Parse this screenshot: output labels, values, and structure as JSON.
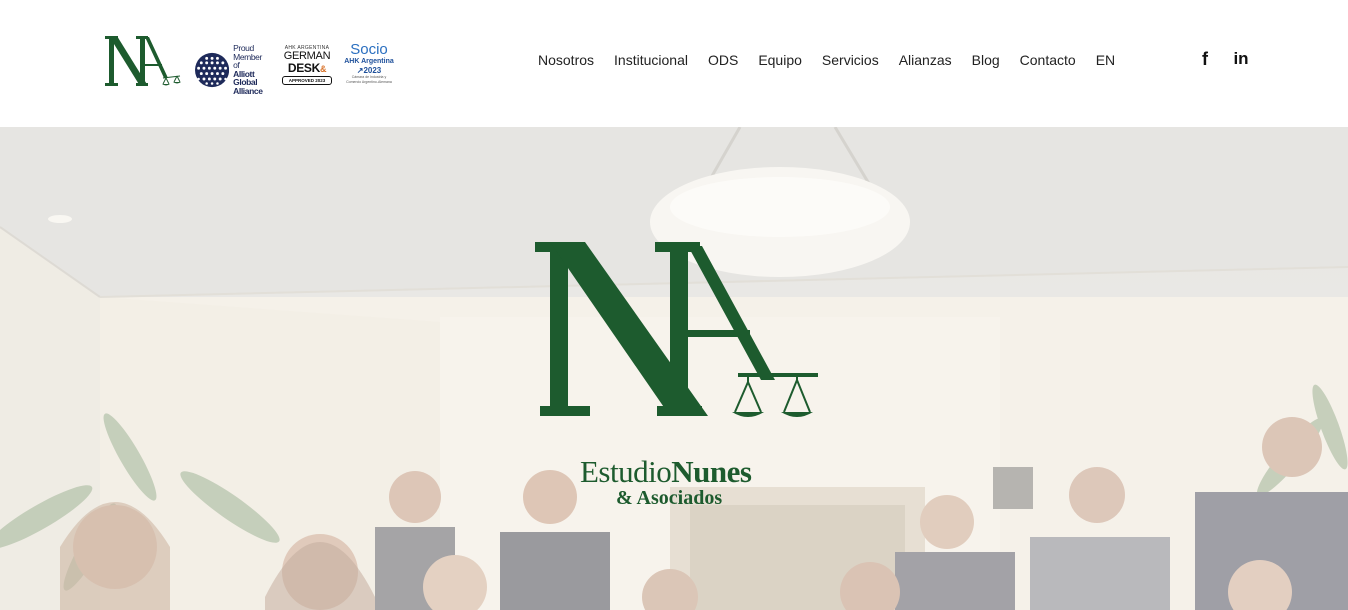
{
  "brand": {
    "logo_icon": "na-scales-logo",
    "alliott": {
      "line1": "Proud",
      "line2": "Member of",
      "line3": "Alliott",
      "line4": "Global",
      "line5": "Alliance"
    },
    "german_desk": {
      "top": "AHK ARGENTINA",
      "line1": "GERMAN",
      "line2": "DESK",
      "amp": "&",
      "foot": "APPROVED 2023"
    },
    "socio": {
      "title": "Socio",
      "sub": "AHK Argentina",
      "year": "↗2023",
      "small1": "Cámara de Industria y",
      "small2": "Comercio Argentino-Alemana"
    }
  },
  "nav": {
    "items": [
      {
        "label": "Nosotros"
      },
      {
        "label": "Institucional"
      },
      {
        "label": "ODS"
      },
      {
        "label": "Equipo"
      },
      {
        "label": "Servicios"
      },
      {
        "label": "Alianzas"
      },
      {
        "label": "Blog"
      },
      {
        "label": "Contacto"
      },
      {
        "label": "EN"
      }
    ]
  },
  "social": {
    "facebook": {
      "icon": "facebook-icon",
      "glyph": "f"
    },
    "linkedin": {
      "icon": "linkedin-icon",
      "glyph": "in"
    }
  },
  "hero": {
    "name_line1_light": "Estudio",
    "name_line1_bold": "Nunes",
    "name_line2": "& Asociados"
  },
  "colors": {
    "brand_green": "#1d5b2e",
    "nav_text": "#222222",
    "alliott_navy": "#1e2a5a",
    "socio_blue": "#2a6fc0"
  }
}
